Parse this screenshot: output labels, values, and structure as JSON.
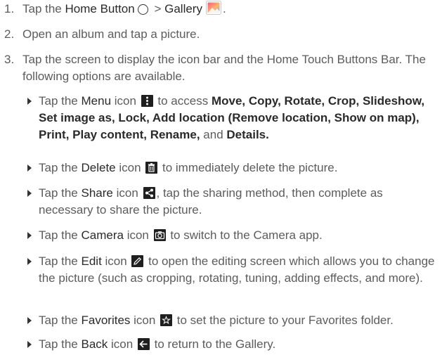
{
  "steps": [
    {
      "num": "1.",
      "a": "Tap the ",
      "b": "Home Button",
      "c": " > ",
      "d": "Gallery",
      "e": "."
    },
    {
      "num": "2.",
      "text": "Open an album and tap a picture."
    },
    {
      "num": "3.",
      "text": "Tap the screen to display the icon bar and the Home Touch Buttons Bar. The following options are available."
    }
  ],
  "bullets": [
    {
      "a": "Tap the ",
      "term": "Menu",
      "b": " icon ",
      "c": " to access ",
      "options": "Move, Copy, Rotate, Crop, Slideshow, Set image as, Lock, Add location (Remove location, Show on map), Print, Play content, Rename,",
      "d": " and ",
      "last": "Details."
    },
    {
      "a": "Tap the ",
      "term": "Delete",
      "b": " icon ",
      "c": " to immediately delete the picture."
    },
    {
      "a": "Tap the ",
      "term": "Share",
      "b": " icon ",
      "c": ", tap the sharing method, then complete as necessary to share the picture."
    },
    {
      "a": "Tap the ",
      "term": "Camera",
      "b": " icon ",
      "c": " to switch to the Camera app."
    },
    {
      "a": "Tap the ",
      "term": "Edit",
      "b": " icon ",
      "c": " to open the editing screen which allows you to change the picture (such as cropping, rotating, tuning, adding effects, and more)."
    },
    {
      "a": "Tap the ",
      "term": "Favorites",
      "b": " icon ",
      "c": " to set the picture to your Favorites folder."
    },
    {
      "a": "Tap the ",
      "term": "Back",
      "b": " icon ",
      "c": " to return to the Gallery."
    }
  ],
  "icons": {
    "home": "home-button-icon",
    "gallery": "gallery-app-icon",
    "menu": "menu-icon",
    "delete": "trash-icon",
    "share": "share-icon",
    "camera": "camera-icon",
    "edit": "pencil-icon",
    "favorites": "star-icon",
    "back": "back-arrow-icon"
  },
  "colors": {
    "body_text": "#5c5c5c",
    "term_text": "#2a2a2a",
    "icon_fill": "#1f1f1f"
  }
}
